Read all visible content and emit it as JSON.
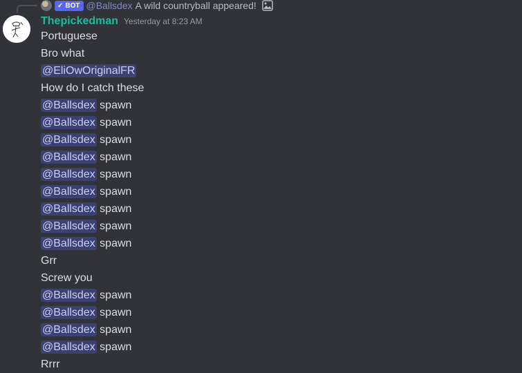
{
  "reply": {
    "bot_label": "BOT",
    "mention": "@Ballsdex",
    "text": "A wild countryball appeared!"
  },
  "header": {
    "username": "Thepickedman",
    "timestamp": "Yesterday at 8:23 AM"
  },
  "messages": [
    {
      "mention": "",
      "text": "Portuguese"
    },
    {
      "mention": "",
      "text": "Bro what"
    },
    {
      "mention": "@EliOwOriginalFR",
      "text": ""
    },
    {
      "mention": "",
      "text": "How do I catch these"
    },
    {
      "mention": "@Ballsdex",
      "text": "spawn"
    },
    {
      "mention": "@Ballsdex",
      "text": "spawn"
    },
    {
      "mention": "@Ballsdex",
      "text": "spawn"
    },
    {
      "mention": "@Ballsdex",
      "text": "spawn"
    },
    {
      "mention": "@Ballsdex",
      "text": "spawn"
    },
    {
      "mention": "@Ballsdex",
      "text": "spawn"
    },
    {
      "mention": "@Ballsdex",
      "text": "spawn"
    },
    {
      "mention": "@Ballsdex",
      "text": "spawn"
    },
    {
      "mention": "@Ballsdex",
      "text": "spawn"
    },
    {
      "mention": "",
      "text": "Grr"
    },
    {
      "mention": "",
      "text": "Screw you"
    },
    {
      "mention": "@Ballsdex",
      "text": "spawn"
    },
    {
      "mention": "@Ballsdex",
      "text": "spawn"
    },
    {
      "mention": "@Ballsdex",
      "text": "spawn"
    },
    {
      "mention": "@Ballsdex",
      "text": "spawn"
    },
    {
      "mention": "",
      "text": "Rrrr"
    }
  ],
  "colors": {
    "background": "#313338",
    "username": "#1abc9c",
    "mention_bg": "rgba(88,101,242,0.3)",
    "mention_text": "#c9cdfb",
    "bot_tag": "#5865f2"
  }
}
